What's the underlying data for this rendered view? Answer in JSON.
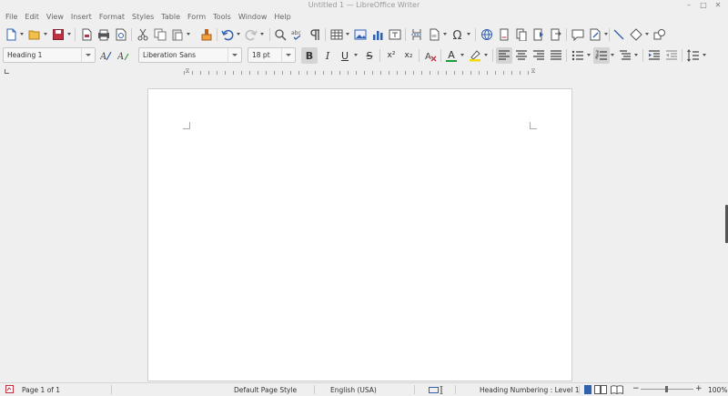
{
  "window": {
    "title": "Untitled 1 — LibreOffice Writer",
    "minimize": "–",
    "maximize": "□",
    "close": "✕"
  },
  "menu": [
    "File",
    "Edit",
    "View",
    "Insert",
    "Format",
    "Styles",
    "Table",
    "Form",
    "Tools",
    "Window",
    "Help"
  ],
  "formatting": {
    "paragraph_style": "Heading 1",
    "font_name": "Liberation Sans",
    "font_size": "18 pt",
    "bold_label": "B",
    "italic_label": "I",
    "underline_label": "U",
    "strike_label": "S",
    "superscript_label": "x²",
    "subscript_label": "x₂",
    "font_color_label": "A"
  },
  "colors": {
    "font_color": "#1a9e3c",
    "highlight": "#f5d90a",
    "accent": "#3060b0"
  },
  "status": {
    "page": "Page 1 of 1",
    "page_style": "Default Page Style",
    "language": "English (USA)",
    "outline": "Heading Numbering : Level 1",
    "zoom": "100%",
    "zoom_minus": "−",
    "zoom_plus": "+"
  }
}
